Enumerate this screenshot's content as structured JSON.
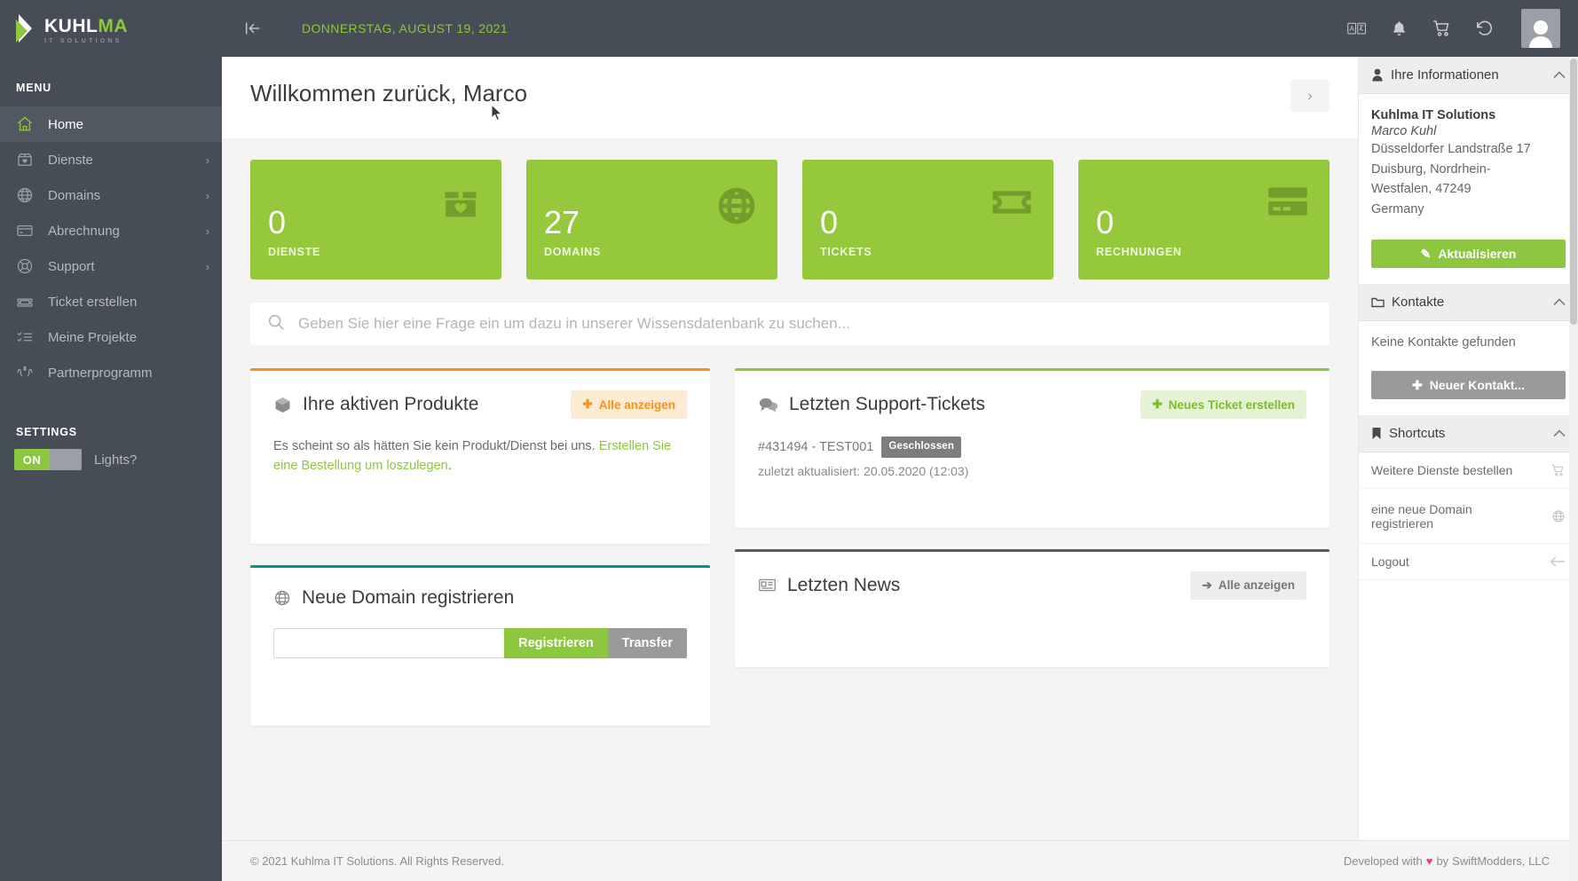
{
  "brand": {
    "logo_primary": "KUHL",
    "logo_accent": "MA",
    "logo_tagline": "IT SOLUTIONS",
    "accent_green": "#8dc63f",
    "sidebar_dark": "#474d56",
    "orange": "#f5921e",
    "teal": "#009688"
  },
  "sidebar": {
    "menu_label": "MENU",
    "items": [
      {
        "label": "Home",
        "icon": "home-icon",
        "has_chevron": false,
        "active": true
      },
      {
        "label": "Dienste",
        "icon": "box-heart-icon",
        "has_chevron": true,
        "active": false
      },
      {
        "label": "Domains",
        "icon": "globe-icon",
        "has_chevron": true,
        "active": false
      },
      {
        "label": "Abrechnung",
        "icon": "credit-card-icon",
        "has_chevron": true,
        "active": false
      },
      {
        "label": "Support",
        "icon": "lifebuoy-icon",
        "has_chevron": true,
        "active": false
      },
      {
        "label": "Ticket erstellen",
        "icon": "ticket-icon",
        "has_chevron": false,
        "active": false
      },
      {
        "label": "Meine Projekte",
        "icon": "checklist-icon",
        "has_chevron": false,
        "active": false
      },
      {
        "label": "Partnerprogramm",
        "icon": "hands-money-icon",
        "has_chevron": false,
        "active": false
      }
    ],
    "settings_label": "SETTINGS",
    "lights_toggle": {
      "state": "ON",
      "label": "Lights?"
    }
  },
  "topbar": {
    "collapse_icon": "collapse-left-icon",
    "date": "DONNERSTAG, AUGUST 19, 2021",
    "icons": [
      "translate-icon",
      "bell-icon",
      "cart-icon",
      "history-icon"
    ],
    "avatar": "user-avatar"
  },
  "welcome": {
    "title": "Willkommen zurück, Marco",
    "next_label": "›"
  },
  "stats": [
    {
      "value": "0",
      "caption": "DIENSTE",
      "icon": "box-heart-icon"
    },
    {
      "value": "27",
      "caption": "DOMAINS",
      "icon": "globe-icon"
    },
    {
      "value": "0",
      "caption": "TICKETS",
      "icon": "ticket-icon"
    },
    {
      "value": "0",
      "caption": "RECHNUNGEN",
      "icon": "credit-card-icon"
    }
  ],
  "search": {
    "placeholder": "Geben Sie hier eine Frage ein um dazu in unserer Wissensdatenbank zu suchen...",
    "value": "",
    "icon": "search-icon"
  },
  "products_panel": {
    "title": "Ihre aktiven Produkte",
    "icon": "box-3d-icon",
    "button": "Alle anzeigen",
    "body_text": "Es scheint so als hätten Sie kein Produkt/Dienst bei uns. ",
    "body_link": "Erstellen Sie eine Bestellung um loszulegen",
    "body_tail": "."
  },
  "tickets_panel": {
    "title": "Letzten Support-Tickets",
    "icon": "chat-bubbles-icon",
    "button": "Neues Ticket erstellen",
    "ticket_id": "#431494 - TEST001",
    "ticket_status": "Geschlossen",
    "ticket_updated": "zuletzt aktualisiert: 20.05.2020 (12:03)"
  },
  "domain_panel": {
    "title": "Neue Domain registrieren",
    "icon": "globe-icon",
    "input_value": "",
    "input_placeholder": "",
    "register_label": "Registrieren",
    "transfer_label": "Transfer"
  },
  "news_panel": {
    "title": "Letzten News",
    "icon": "newspaper-icon",
    "button": "Alle anzeigen"
  },
  "rightbar": {
    "info": {
      "title": "Ihre Informationen",
      "icon": "person-icon",
      "company": "Kuhlma IT Solutions",
      "person": "Marco Kuhl",
      "address_line1": "Düsseldorfer Landstraße 17",
      "address_line2": "Duisburg, Nordrhein-",
      "address_line3": "Westfalen, 47249",
      "address_line4": "Germany",
      "button": "Aktualisieren",
      "button_icon": "pencil-icon"
    },
    "contacts": {
      "title": "Kontakte",
      "icon": "folder-icon",
      "empty_text": "Keine Kontakte gefunden",
      "button": "Neuer Kontakt...",
      "button_icon": "plus-icon"
    },
    "shortcuts": {
      "title": "Shortcuts",
      "icon": "bookmark-icon",
      "items": [
        {
          "label": "Weitere Dienste bestellen",
          "icon": "cart-icon"
        },
        {
          "label": "eine neue Domain registrieren",
          "icon": "globe-icon"
        },
        {
          "label": "Logout",
          "icon": "arrow-left-icon"
        }
      ]
    }
  },
  "footer": {
    "left": "© 2021 Kuhlma IT Solutions. All Rights Reserved.",
    "right_pre": "Developed with",
    "heart": "♥",
    "right_mid": "by",
    "right_company": "SwiftModders, LLC"
  }
}
